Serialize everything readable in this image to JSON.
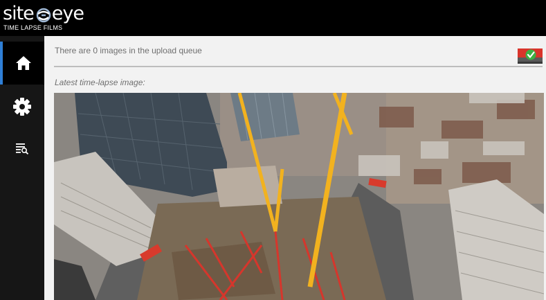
{
  "brand": {
    "word_left": "site",
    "word_right": "eye",
    "tagline": "TIME LAPSE FILMS"
  },
  "sidebar": {
    "items": [
      {
        "name": "home",
        "icon": "home-icon",
        "active": true
      },
      {
        "name": "settings",
        "icon": "gear-icon",
        "active": false
      },
      {
        "name": "logs",
        "icon": "log-search-icon",
        "active": false
      }
    ]
  },
  "main": {
    "queue_status": "There are 0 images in the upload queue",
    "latest_label": "Latest time-lapse image:",
    "status_icon": "connection-ok-icon"
  },
  "colors": {
    "topbar": "#000000",
    "sidebar": "#161616",
    "active_indicator": "#2f7fd6",
    "status_red": "#d9342b",
    "status_green": "#3cb043"
  }
}
